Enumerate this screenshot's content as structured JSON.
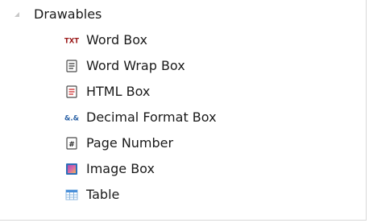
{
  "tree": {
    "group": {
      "label": "Drawables",
      "expanded": true,
      "expander_icon": "expanded-triangle-icon"
    },
    "items": [
      {
        "label": "Word Box",
        "icon": "txt-icon",
        "icon_text": "TXT",
        "icon_color": "#9b1b1b"
      },
      {
        "label": "Word Wrap Box",
        "icon": "document-lines-icon",
        "icon_color": "#2b2b2b"
      },
      {
        "label": "HTML Box",
        "icon": "html-document-icon",
        "icon_color": "#cc2b2b"
      },
      {
        "label": "Decimal Format Box",
        "icon": "decimal-format-icon",
        "icon_text": "&.&",
        "icon_color": "#2b62a6"
      },
      {
        "label": "Page Number",
        "icon": "page-number-icon",
        "icon_text": "#",
        "icon_color": "#222222"
      },
      {
        "label": "Image Box",
        "icon": "image-icon",
        "icon_color": "#2d6fb8"
      },
      {
        "label": "Table",
        "icon": "table-icon",
        "icon_color": "#4a90d9"
      }
    ]
  }
}
